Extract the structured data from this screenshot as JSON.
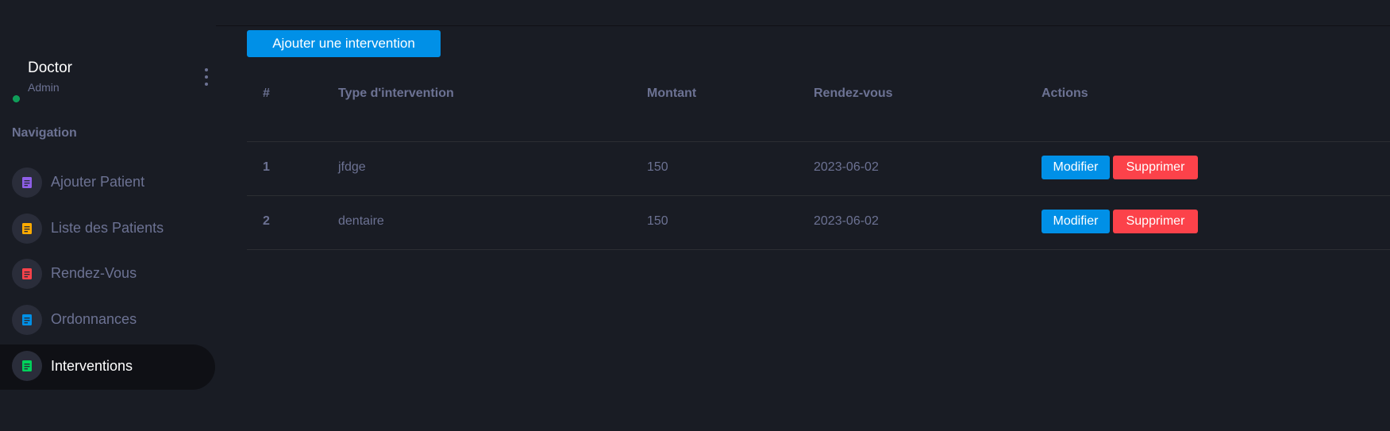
{
  "profile": {
    "name": "Doctor",
    "role": "Admin"
  },
  "sidebar": {
    "heading": "Navigation",
    "items": [
      {
        "label": "Ajouter Patient",
        "icon": "file-document-icon",
        "color": "#8f5fe8"
      },
      {
        "label": "Liste des Patients",
        "icon": "file-document-icon",
        "color": "#ffab00"
      },
      {
        "label": "Rendez-Vous",
        "icon": "file-document-icon",
        "color": "#fc424a"
      },
      {
        "label": "Ordonnances",
        "icon": "file-document-icon",
        "color": "#0090e7"
      },
      {
        "label": "Interventions",
        "icon": "file-document-icon",
        "color": "#00d25b",
        "active": true
      }
    ]
  },
  "main": {
    "add_button": "Ajouter une intervention",
    "table": {
      "headers": [
        "#",
        "Type d'intervention",
        "Montant",
        "Rendez-vous",
        "Actions"
      ],
      "rows": [
        {
          "index": "1",
          "type": "jfdge",
          "amount": "150",
          "appointment": "2023-06-02",
          "edit": "Modifier",
          "delete": "Supprimer"
        },
        {
          "index": "2",
          "type": "dentaire",
          "amount": "150",
          "appointment": "2023-06-02",
          "edit": "Modifier",
          "delete": "Supprimer"
        }
      ]
    }
  },
  "colors": {
    "background": "#191c24",
    "primary": "#0090e7",
    "danger": "#fc424a",
    "online": "#0f9d58"
  }
}
